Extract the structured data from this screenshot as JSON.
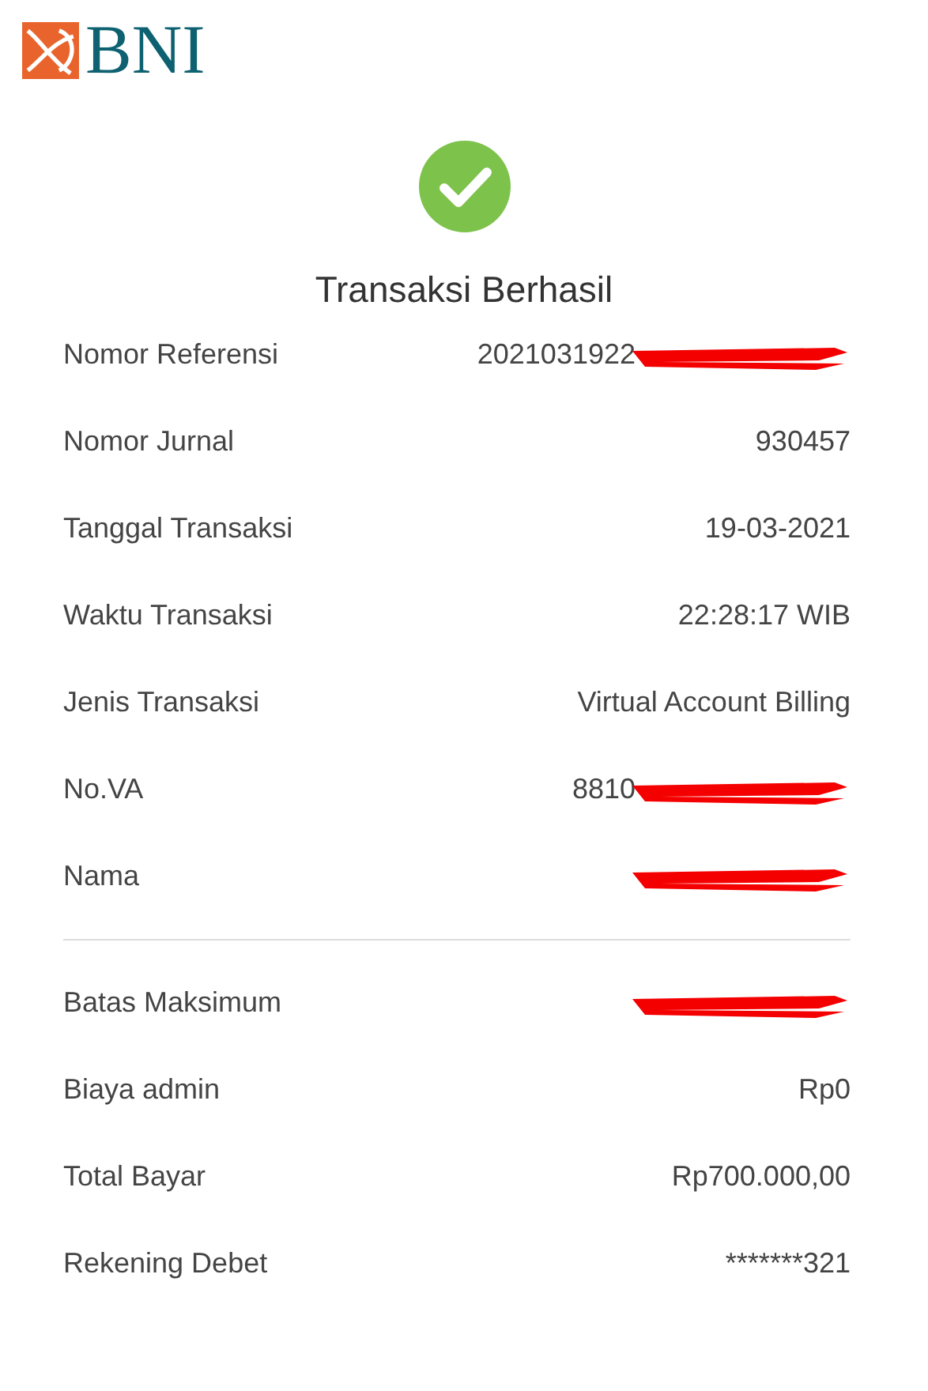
{
  "brand": {
    "name": "BNI"
  },
  "status": {
    "title": "Transaksi Berhasil",
    "success": true
  },
  "details": [
    {
      "label": "Nomor Referensi",
      "value": "2021031922",
      "redacted": true
    },
    {
      "label": "Nomor Jurnal",
      "value": "930457",
      "redacted": false
    },
    {
      "label": "Tanggal Transaksi",
      "value": "19-03-2021",
      "redacted": false
    },
    {
      "label": "Waktu Transaksi",
      "value": "22:28:17 WIB",
      "redacted": false
    },
    {
      "label": "Jenis Transaksi",
      "value": "Virtual Account Billing",
      "redacted": false
    },
    {
      "label": "No.VA",
      "value": "8810",
      "redacted": true
    },
    {
      "label": "Nama",
      "redacted": true
    }
  ],
  "payment": [
    {
      "label": "Batas Maksimum",
      "redacted": true
    },
    {
      "label": "Biaya admin",
      "value": "Rp0",
      "redacted": false
    },
    {
      "label": "Total Bayar",
      "value": "Rp700.000,00",
      "redacted": false
    },
    {
      "label": "Rekening Debet",
      "value": "*******321",
      "redacted": false
    }
  ]
}
